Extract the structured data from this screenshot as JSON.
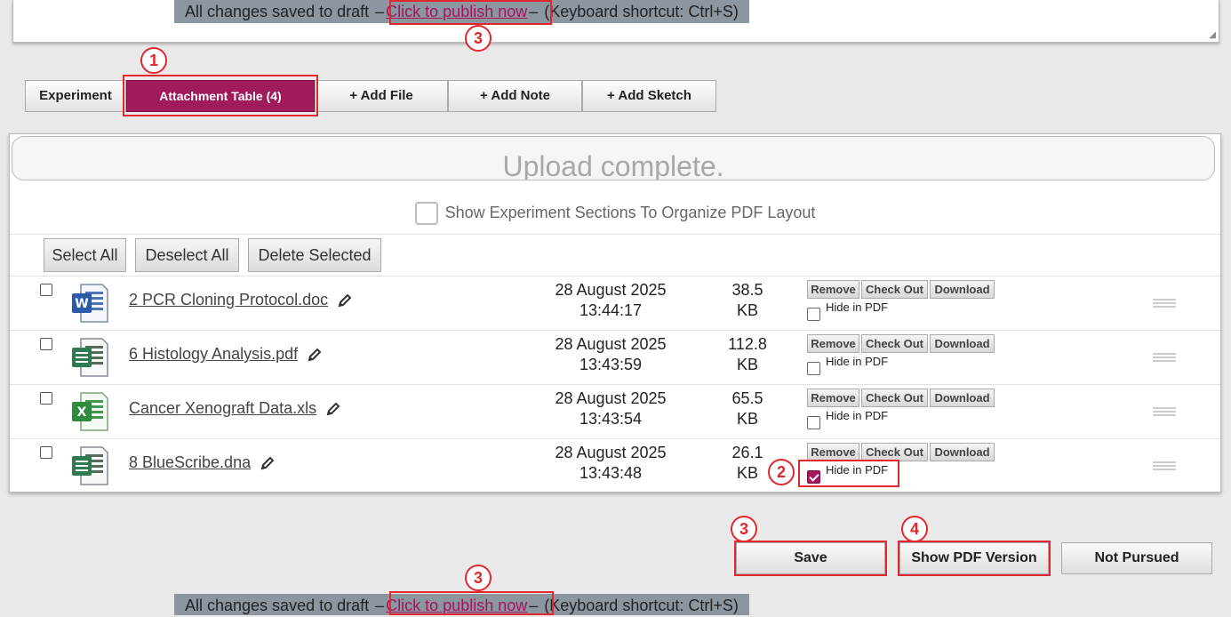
{
  "draft_bar": {
    "saved_text": "All changes saved to draft",
    "dash": "–",
    "publish_link": "Click to publish now",
    "shortcut_text": "(Keyboard shortcut: Ctrl+S)"
  },
  "tabs": [
    {
      "label": "Experiment"
    },
    {
      "label": "Attachment Table (4)",
      "active": true
    },
    {
      "label": "+ Add File"
    },
    {
      "label": "+ Add Note"
    },
    {
      "label": "+ Add Sketch"
    }
  ],
  "upload_status": "Upload complete.",
  "pdf_layout_option": "Show Experiment Sections To Organize PDF Layout",
  "bulk_actions": {
    "select_all": "Select All",
    "deselect_all": "Deselect All",
    "delete_selected": "Delete Selected"
  },
  "row_actions": {
    "remove": "Remove",
    "check_out": "Check Out",
    "download": "Download",
    "hide_in_pdf": "Hide in PDF"
  },
  "attachments": [
    {
      "name": "2 PCR Cloning Protocol.doc",
      "icon": "word-doc-icon",
      "date": "28 August 2025",
      "time": "13:44:17",
      "size": "38.5",
      "unit": "KB",
      "hidden_in_pdf": false
    },
    {
      "name": "6 Histology Analysis.pdf",
      "icon": "generic-file-icon",
      "date": "28 August 2025",
      "time": "13:43:59",
      "size": "112.8",
      "unit": "KB",
      "hidden_in_pdf": false
    },
    {
      "name": "Cancer Xenograft Data.xls",
      "icon": "excel-xls-icon",
      "date": "28 August 2025",
      "time": "13:43:54",
      "size": "65.5",
      "unit": "KB",
      "hidden_in_pdf": false
    },
    {
      "name": "8 BlueScribe.dna",
      "icon": "generic-file-icon",
      "date": "28 August 2025",
      "time": "13:43:48",
      "size": "26.1",
      "unit": "KB",
      "hidden_in_pdf": true
    }
  ],
  "buttons": {
    "save": "Save",
    "show_pdf": "Show PDF Version",
    "not_pursued": "Not Pursued"
  },
  "annotations": [
    "1",
    "2",
    "3",
    "3",
    "3",
    "4"
  ],
  "colors": {
    "accent": "#a01a5c",
    "annotation_red": "#e0282e",
    "draft_bar_bg": "#8c96a0"
  }
}
